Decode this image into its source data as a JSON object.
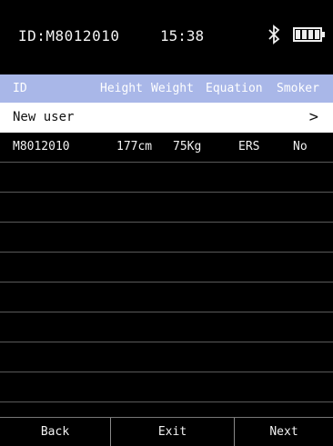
{
  "status_bar": {
    "device_id": "ID:M8012010",
    "time": "15:38",
    "bluetooth_icon": "bluetooth-icon",
    "battery_icon": "battery-full-icon",
    "battery_level": 1.0
  },
  "columns": {
    "id": "ID",
    "height": "Height",
    "weight": "Weight",
    "equation": "Equation",
    "smoker": "Smoker"
  },
  "new_user": {
    "label": "New user",
    "chevron": ">"
  },
  "records": [
    {
      "id": "M8012010",
      "height": "177cm",
      "weight": "75Kg",
      "equation": "ERS",
      "smoker": "No"
    }
  ],
  "empty_row_count": 9,
  "nav": {
    "back": "Back",
    "exit": "Exit",
    "next": "Next"
  },
  "colors": {
    "header_bg": "#a9b7e8",
    "background": "#000000",
    "row_highlight": "#ffffff"
  }
}
